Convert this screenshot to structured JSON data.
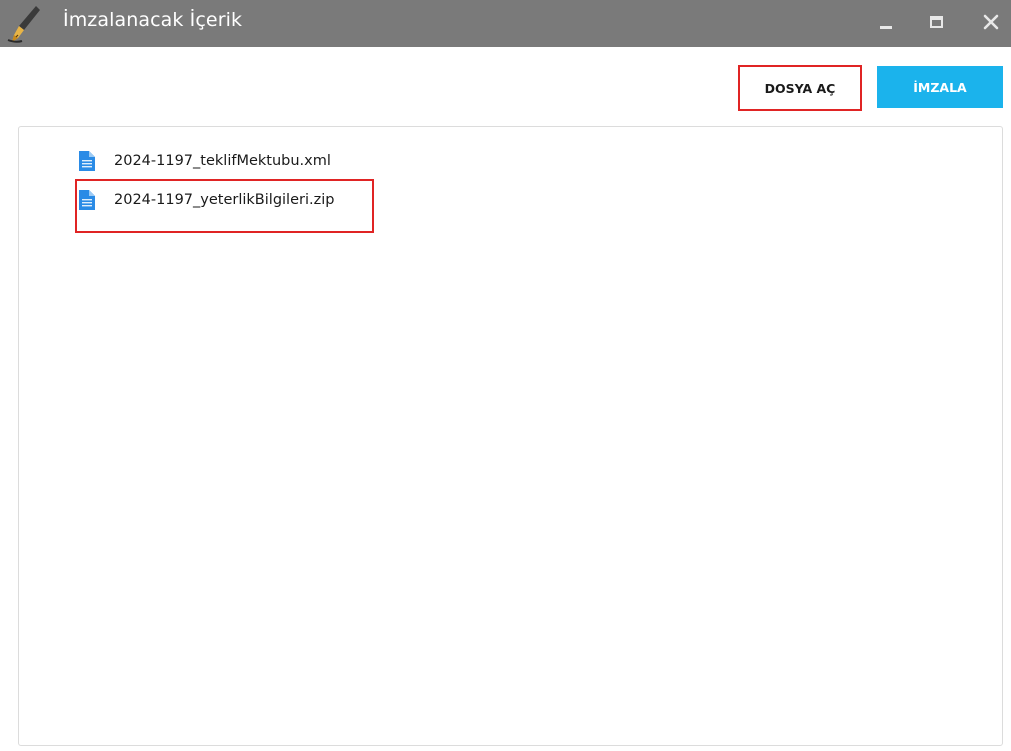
{
  "window": {
    "title": "İmzalanacak İçerik",
    "controls": [
      "minimize-icon",
      "maximize-icon",
      "close-icon"
    ]
  },
  "toolbar": {
    "open_label": "DOSYA AÇ",
    "sign_label": "İMZALA"
  },
  "files": [
    {
      "name": "2024-1197_teklifMektubu.xml",
      "icon": "document-icon"
    },
    {
      "name": "2024-1197_yeterlikBilgileri.zip",
      "icon": "document-icon"
    }
  ],
  "colors": {
    "titlebar": "#7a7a7a",
    "sign_button": "#1bb3ec",
    "highlight": "#e02424",
    "file_icon": "#2a8be6"
  }
}
